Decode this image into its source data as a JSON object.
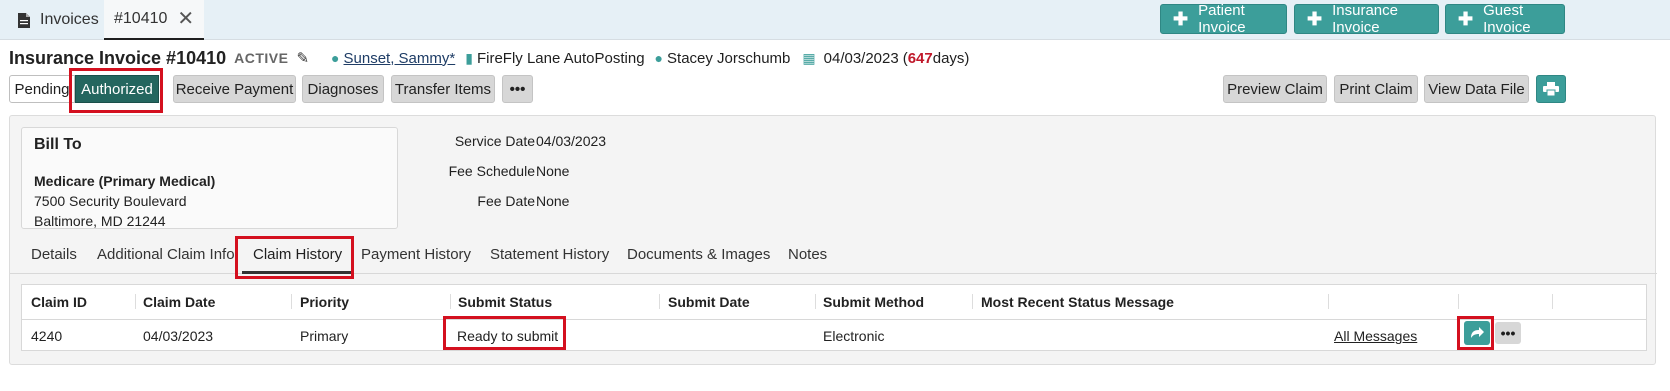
{
  "top_tabs": {
    "invoices": "Invoices",
    "current": "#10410"
  },
  "top_actions": {
    "patient_invoice": "Patient Invoice",
    "insurance_invoice": "Insurance Invoice",
    "guest_invoice": "Guest Invoice"
  },
  "header": {
    "title": "Insurance Invoice #10410",
    "status": "ACTIVE",
    "patient": "Sunset, Sammy*",
    "location": "FireFly Lane AutoPosting",
    "provider": "Stacey Jorschumb",
    "date": "04/03/2023",
    "days_open": "(",
    "days_count": "647",
    "days_suffix": " days)"
  },
  "actions": {
    "pending": "Pending",
    "authorized": "Authorized",
    "receive_payment": "Receive Payment",
    "diagnoses": "Diagnoses",
    "transfer_items": "Transfer Items",
    "more": "•••",
    "preview_claim": "Preview Claim",
    "print_claim": "Print Claim",
    "view_data_file": "View Data File"
  },
  "bill_to": {
    "heading": "Bill To",
    "name": "Medicare (Primary Medical)",
    "address1": "7500 Security Boulevard",
    "address2": "Baltimore, MD 21244"
  },
  "info": {
    "service_date_label": "Service Date",
    "service_date": "04/03/2023",
    "fee_schedule_label": "Fee Schedule",
    "fee_schedule": "None",
    "fee_date_label": "Fee Date",
    "fee_date": "None"
  },
  "tabs": [
    "Details",
    "Additional Claim Info",
    "Claim History",
    "Payment History",
    "Statement History",
    "Documents & Images",
    "Notes"
  ],
  "table": {
    "headers": [
      "Claim ID",
      "Claim Date",
      "Priority",
      "Submit Status",
      "Submit Date",
      "Submit Method",
      "Most Recent Status Message"
    ],
    "row": {
      "claim_id": "4240",
      "claim_date": "04/03/2023",
      "priority": "Primary",
      "submit_status": "Ready to submit",
      "submit_date": "",
      "submit_method": "Electronic",
      "status_message": "",
      "messages_link": "All Messages"
    }
  },
  "colors": {
    "teal": "#3c9e9a",
    "dark_teal": "#24665f",
    "highlight": "#d4101f",
    "days_red": "#c0182a"
  }
}
